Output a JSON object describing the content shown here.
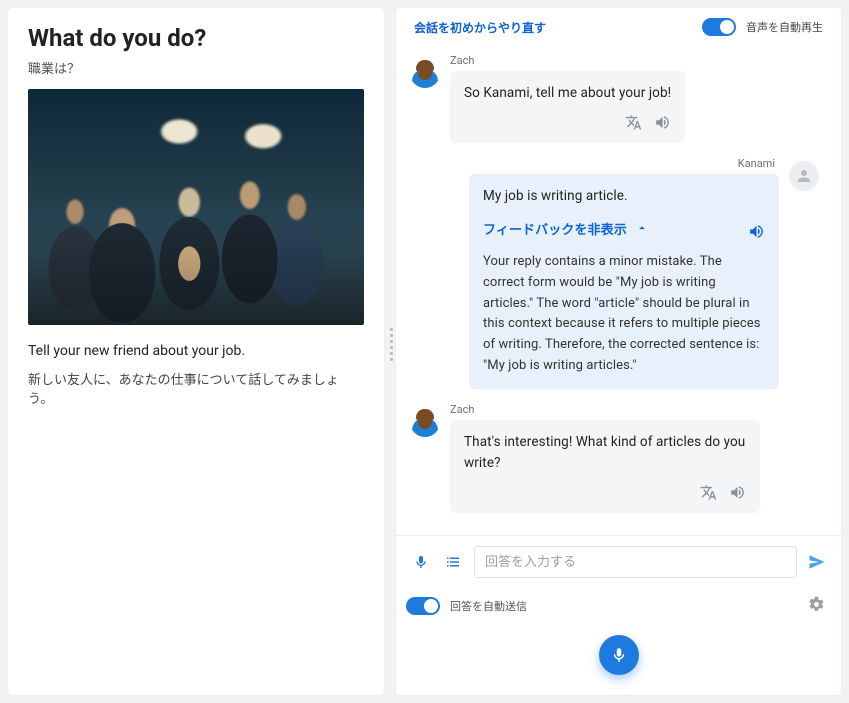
{
  "left": {
    "title_en": "What do you do?",
    "title_jp": "職業は？",
    "prompt_en": "Tell your new friend about your job.",
    "prompt_jp": "新しい友人に、あなたの仕事について話してみましょう。"
  },
  "header": {
    "restart_label": "会話を初めからやり直す",
    "auto_play_label": "音声を自動再生",
    "auto_play_on": true
  },
  "messages": [
    {
      "side": "left",
      "sender": "Zach",
      "avatar": "zach",
      "text": "So Kanami, tell me about your job!",
      "actions": [
        "translate",
        "speaker"
      ]
    },
    {
      "side": "right",
      "sender": "Kanami",
      "avatar": "user",
      "text": "My job is writing article.",
      "feedback": {
        "toggle_label": "フィードバックを非表示",
        "expanded": true,
        "body": "Your reply contains a minor mistake. The correct form would be \"My job is writing articles.\" The word \"article\" should be plural in this context because it refers to multiple pieces of writing. Therefore, the corrected sentence is: \"My job is writing articles.\""
      }
    },
    {
      "side": "left",
      "sender": "Zach",
      "avatar": "zach",
      "text": "That's interesting! What kind of articles do you write?",
      "actions": [
        "translate",
        "speaker"
      ]
    }
  ],
  "input": {
    "placeholder": "回答を入力する"
  },
  "footer": {
    "auto_send_label": "回答を自動送信",
    "auto_send_on": true
  },
  "icons": {
    "translate": "translate-icon",
    "speaker": "speaker-icon",
    "mic": "microphone-icon",
    "list": "list-icon",
    "send": "send-icon",
    "gear": "gear-icon",
    "chevron_up": "chevron-up-icon"
  }
}
